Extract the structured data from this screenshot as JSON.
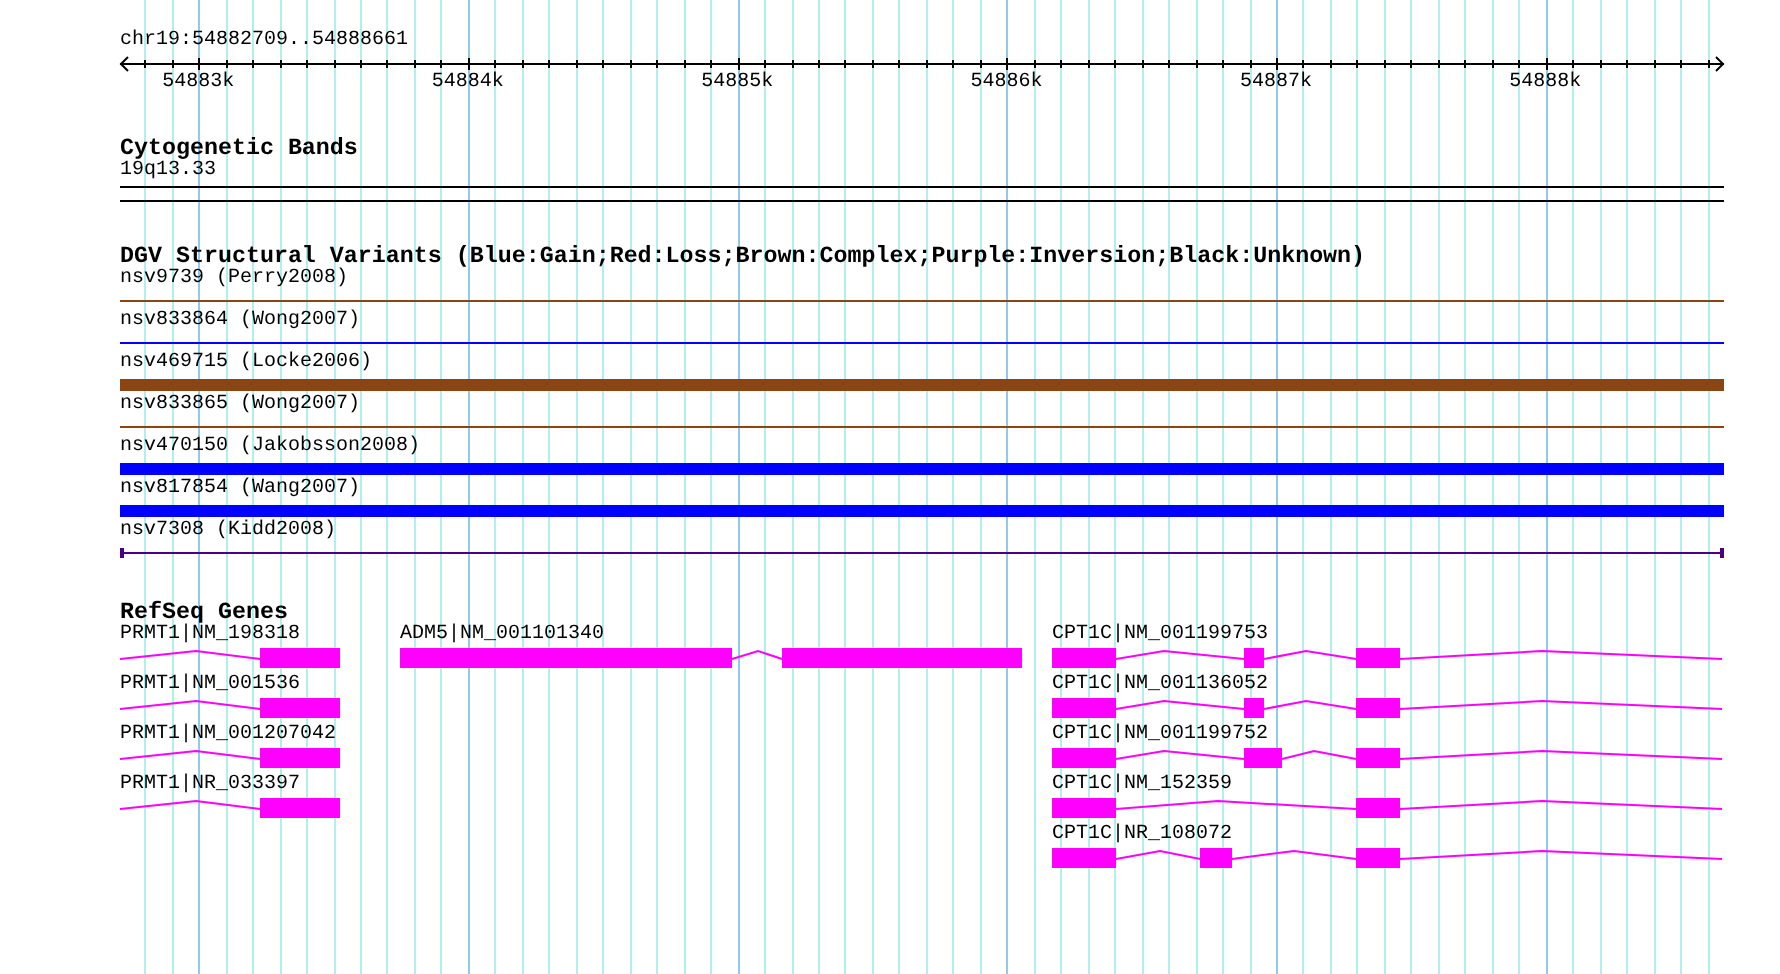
{
  "ruler": {
    "range": "chr19:54882709..54888661",
    "ticks": [
      "54883k",
      "54884k",
      "54885k",
      "54886k",
      "54887k",
      "54888k"
    ]
  },
  "cytogenetic_bands": {
    "title": "Cytogenetic Bands",
    "bands": [
      {
        "label": "19q13.33"
      }
    ]
  },
  "dgv": {
    "title": "DGV Structural Variants (Blue:Gain;Red:Loss;Brown:Complex;Purple:Inversion;Black:Unknown)",
    "variants": [
      {
        "label": "nsv9739 (Perry2008)",
        "color": "#8b4513",
        "kind": "line"
      },
      {
        "label": "nsv833864 (Wong2007)",
        "color": "#0000ff",
        "kind": "line"
      },
      {
        "label": "nsv469715 (Locke2006)",
        "color": "#8b4513",
        "kind": "bar"
      },
      {
        "label": "nsv833865 (Wong2007)",
        "color": "#8b4513",
        "kind": "line"
      },
      {
        "label": "nsv470150 (Jakobsson2008)",
        "color": "#0000ff",
        "kind": "bar"
      },
      {
        "label": "nsv817854 (Wang2007)",
        "color": "#0000ff",
        "kind": "bar"
      },
      {
        "label": "nsv7308 (Kidd2008)",
        "color": "#4b0082",
        "kind": "span"
      }
    ]
  },
  "refseq": {
    "title": "RefSeq Genes",
    "genes": [
      {
        "label": "PRMT1|NM_198318"
      },
      {
        "label": "ADM5|NM_001101340"
      },
      {
        "label": "CPT1C|NM_001199753"
      },
      {
        "label": "PRMT1|NM_001536"
      },
      {
        "label": "CPT1C|NM_001136052"
      },
      {
        "label": "PRMT1|NM_001207042"
      },
      {
        "label": "CPT1C|NM_001199752"
      },
      {
        "label": "PRMT1|NR_033397"
      },
      {
        "label": "CPT1C|NM_152359"
      },
      {
        "label": "CPT1C|NR_108072"
      }
    ]
  }
}
